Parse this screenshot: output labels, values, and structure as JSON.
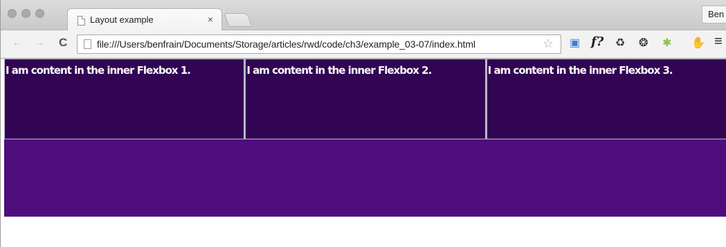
{
  "browser": {
    "tab_title": "Layout example",
    "tab_close": "×",
    "profile_name": "Ben",
    "url": "file:///Users/benfrain/Documents/Storage/articles/rwd/code/ch3/example_03-07/index.html",
    "back_glyph": "←",
    "forward_glyph": "→",
    "reload_glyph": "C",
    "bookmark_glyph": "☆",
    "extensions": [
      {
        "name": "calendar-extension-icon",
        "glyph": "▣",
        "color": "#3b7dd8"
      },
      {
        "name": "font-finder-icon",
        "glyph": "f?",
        "color": "#222222"
      },
      {
        "name": "recycle-icon",
        "glyph": "♻",
        "color": "#333333"
      },
      {
        "name": "sync-icon",
        "glyph": "❂",
        "color": "#222222"
      },
      {
        "name": "android-icon",
        "glyph": "✱",
        "color": "#8bc34a"
      },
      {
        "name": "hand-icon",
        "glyph": "✋",
        "color": "#555555"
      },
      {
        "name": "menu-icon",
        "glyph": "≡",
        "color": "#222222"
      }
    ]
  },
  "page": {
    "boxes": [
      "I am content in the inner Flexbox 1.",
      "I am content in the inner Flexbox 2.",
      "I am content in the inner Flexbox 3."
    ],
    "colors": {
      "inner_box": "#320454",
      "outer_flex": "#4f0c7c",
      "background": "#ffffff"
    }
  }
}
